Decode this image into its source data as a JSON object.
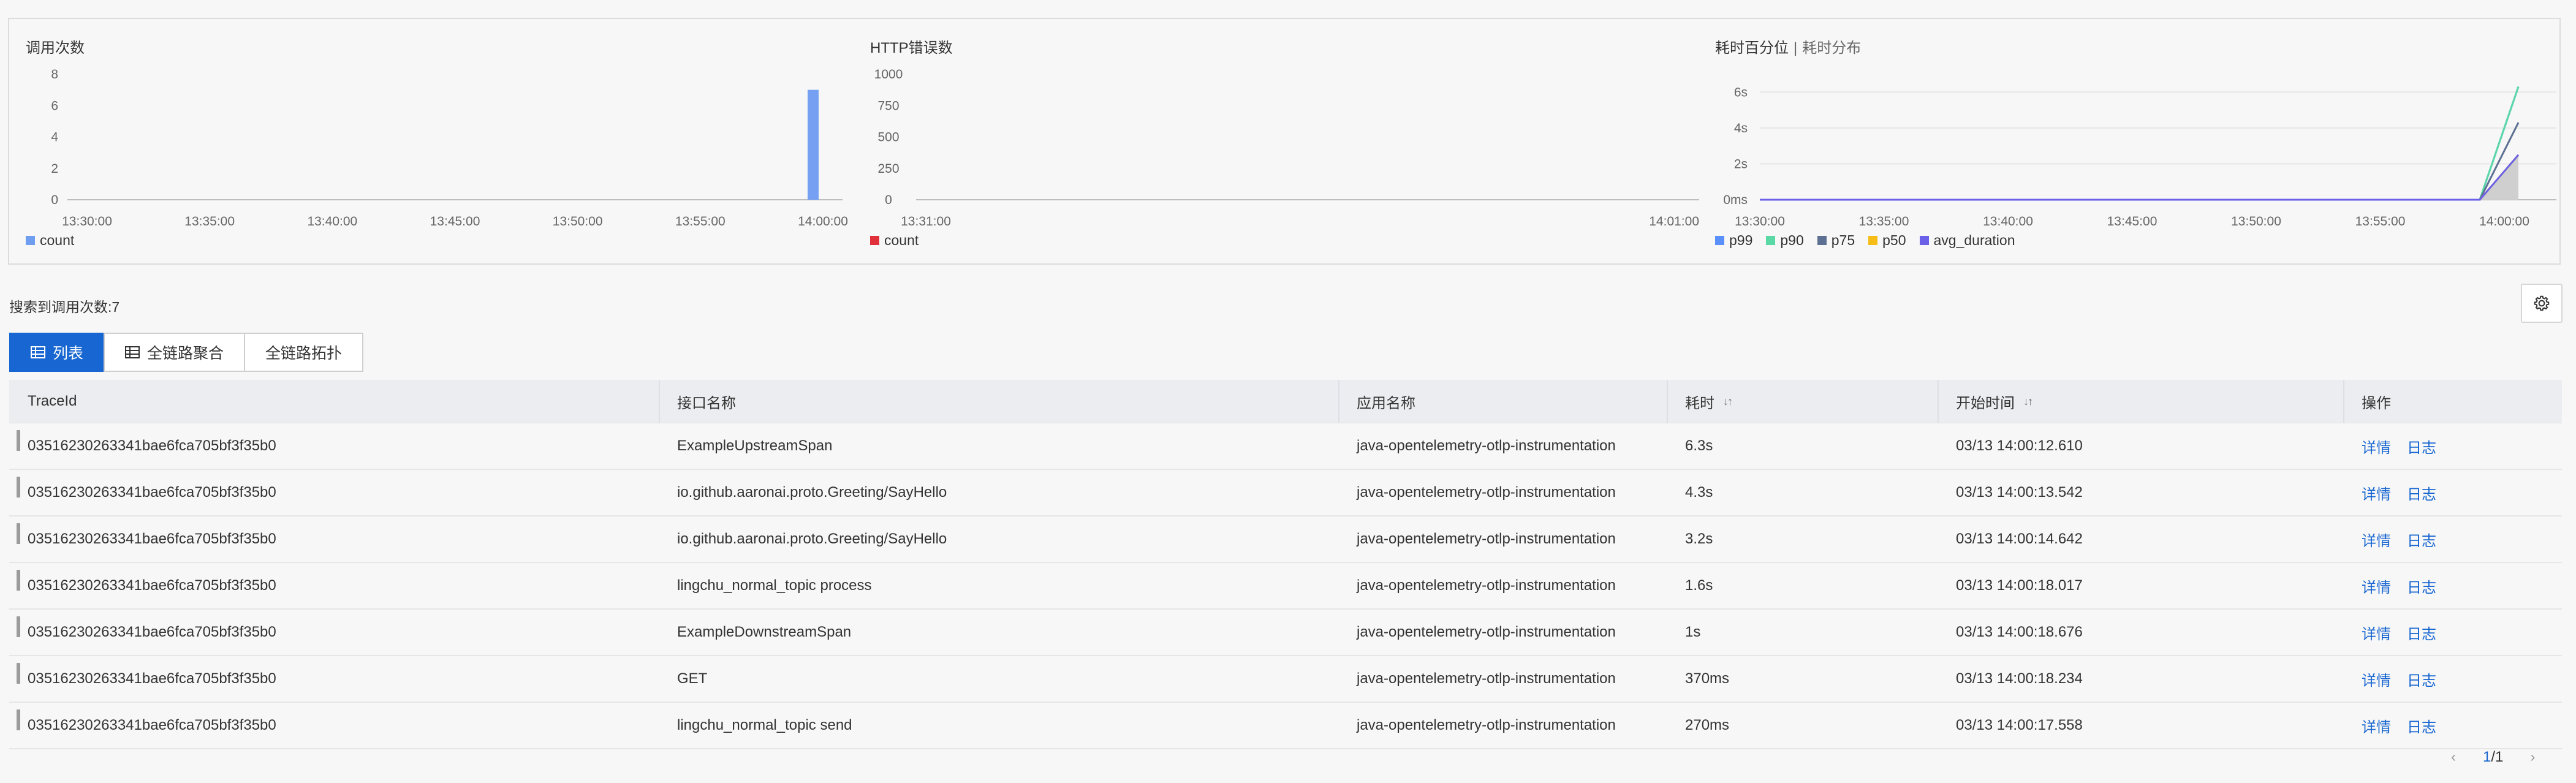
{
  "charts": [
    {
      "title": "调用次数",
      "type": "bar",
      "y_ticks": [
        "8",
        "6",
        "4",
        "2",
        "0"
      ],
      "x_ticks": [
        "13:30:00",
        "13:35:00",
        "13:40:00",
        "13:45:00",
        "13:50:00",
        "13:55:00",
        "14:00:00"
      ],
      "legend": [
        {
          "label": "count",
          "color": "#6f9ef0"
        }
      ]
    },
    {
      "title": "HTTP错误数",
      "type": "bar",
      "y_ticks": [
        "1000",
        "750",
        "500",
        "250",
        "0"
      ],
      "x_ticks": [
        "13:31:00",
        "14:01:00"
      ],
      "legend": [
        {
          "label": "count",
          "color": "#e0303a"
        }
      ]
    },
    {
      "title": "耗时百分位",
      "sep": "|",
      "subtitle": "耗时分布",
      "type": "area",
      "y_ticks": [
        "6s",
        "4s",
        "2s",
        "0ms"
      ],
      "x_ticks": [
        "13:30:00",
        "13:35:00",
        "13:40:00",
        "13:45:00",
        "13:50:00",
        "13:55:00",
        "14:00:00"
      ],
      "legend": [
        {
          "label": "p99",
          "color": "#5b8ff9"
        },
        {
          "label": "p90",
          "color": "#5ad8a6"
        },
        {
          "label": "p75",
          "color": "#5d7092"
        },
        {
          "label": "p50",
          "color": "#f6bd16"
        },
        {
          "label": "avg_duration",
          "color": "#6b60e8"
        }
      ]
    }
  ],
  "chart_data": [
    {
      "type": "bar",
      "title": "调用次数",
      "x": [
        "13:30:00",
        "13:35:00",
        "13:40:00",
        "13:45:00",
        "13:50:00",
        "13:55:00",
        "14:00:00"
      ],
      "series": [
        {
          "name": "count",
          "points": [
            [
              "14:00:00",
              7
            ]
          ]
        }
      ],
      "ylim": [
        0,
        8
      ]
    },
    {
      "type": "bar",
      "title": "HTTP错误数",
      "x": [
        "13:31:00",
        "14:01:00"
      ],
      "series": [
        {
          "name": "count",
          "points": []
        }
      ],
      "ylim": [
        0,
        1000
      ]
    },
    {
      "type": "area",
      "title": "耗时百分位",
      "x": [
        "13:30:00",
        "13:35:00",
        "13:40:00",
        "13:45:00",
        "13:50:00",
        "13:55:00",
        "14:00:00"
      ],
      "yunit": "s",
      "ylim": [
        0,
        7
      ],
      "series": [
        {
          "name": "p99",
          "final": 6.3
        },
        {
          "name": "p90",
          "final": 6.3
        },
        {
          "name": "p75",
          "final": 4.3
        },
        {
          "name": "p50",
          "final": 2.5
        },
        {
          "name": "avg_duration",
          "final": 2.5
        }
      ]
    }
  ],
  "search_count": "搜索到调用次数:7",
  "tabs": [
    {
      "label": "列表",
      "active": true,
      "icon": "table-icon"
    },
    {
      "label": "全链路聚合",
      "active": false,
      "icon": "table-icon"
    },
    {
      "label": "全链路拓扑",
      "active": false
    }
  ],
  "table": {
    "headers": [
      "TraceId",
      "接口名称",
      "应用名称",
      "耗时",
      "开始时间",
      "操作"
    ],
    "rows": [
      {
        "trace": "03516230263341bae6fca705bf3f35b0",
        "api": "ExampleUpstreamSpan",
        "app": "java-opentelemetry-otlp-instrumentation",
        "dur": "6.3s",
        "start": "03/13 14:00:12.610"
      },
      {
        "trace": "03516230263341bae6fca705bf3f35b0",
        "api": "io.github.aaronai.proto.Greeting/SayHello",
        "app": "java-opentelemetry-otlp-instrumentation",
        "dur": "4.3s",
        "start": "03/13 14:00:13.542"
      },
      {
        "trace": "03516230263341bae6fca705bf3f35b0",
        "api": "io.github.aaronai.proto.Greeting/SayHello",
        "app": "java-opentelemetry-otlp-instrumentation",
        "dur": "3.2s",
        "start": "03/13 14:00:14.642"
      },
      {
        "trace": "03516230263341bae6fca705bf3f35b0",
        "api": "lingchu_normal_topic process",
        "app": "java-opentelemetry-otlp-instrumentation",
        "dur": "1.6s",
        "start": "03/13 14:00:18.017"
      },
      {
        "trace": "03516230263341bae6fca705bf3f35b0",
        "api": "ExampleDownstreamSpan",
        "app": "java-opentelemetry-otlp-instrumentation",
        "dur": "1s",
        "start": "03/13 14:00:18.676"
      },
      {
        "trace": "03516230263341bae6fca705bf3f35b0",
        "api": "GET",
        "app": "java-opentelemetry-otlp-instrumentation",
        "dur": "370ms",
        "start": "03/13 14:00:18.234"
      },
      {
        "trace": "03516230263341bae6fca705bf3f35b0",
        "api": "lingchu_normal_topic send",
        "app": "java-opentelemetry-otlp-instrumentation",
        "dur": "270ms",
        "start": "03/13 14:00:17.558"
      }
    ],
    "action_detail": "详情",
    "action_log": "日志"
  },
  "pagination": {
    "current": "1",
    "total": "/1"
  }
}
